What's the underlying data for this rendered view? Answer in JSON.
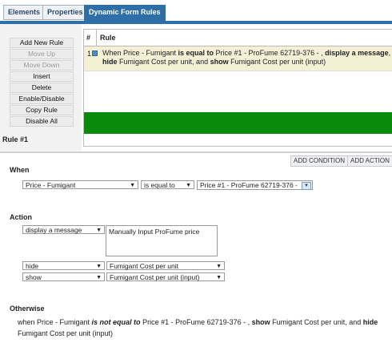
{
  "tabs": [
    {
      "label": "Elements"
    },
    {
      "label": "Properties"
    },
    {
      "label": "Dynamic Form Rules"
    }
  ],
  "left_buttons": [
    {
      "label": "Add New Rule"
    },
    {
      "label": "Move Up"
    },
    {
      "label": "Move Down"
    },
    {
      "label": "Insert"
    },
    {
      "label": "Delete"
    },
    {
      "label": "Enable/Disable"
    },
    {
      "label": "Copy Rule"
    },
    {
      "label": "Disable All"
    }
  ],
  "table": {
    "col_num": "#",
    "col_rule": "Rule",
    "row": {
      "num": "1",
      "parts": [
        "When Price - Fumigant ",
        "is equal to",
        " Price #1 - ProFume 62719-376 - , ",
        "display a message",
        ", ",
        "hide",
        " Fumigant Cost per unit, and ",
        "show",
        " Fumigant Cost per unit (input)"
      ]
    }
  },
  "rule_title": "Rule #1",
  "actions_toolbar": {
    "add_condition": "ADD CONDITION",
    "add_action": "ADD ACTION"
  },
  "when": {
    "heading": "When",
    "field": "Price - Fumigant",
    "operator": "is equal to",
    "value": "Price #1 - ProFume 62719-376 -"
  },
  "action": {
    "heading": "Action",
    "rows": [
      {
        "type": "display a message",
        "target": "Manually Input ProFume price"
      },
      {
        "type": "hide",
        "target": "Fumigant Cost per unit"
      },
      {
        "type": "show",
        "target": "Fumigant Cost per unit (input)"
      }
    ]
  },
  "otherwise": {
    "heading": "Otherwise",
    "parts": [
      "when Price - Fumigant ",
      "is not equal to",
      " Price #1 - ProFume 62719-376 - , ",
      "show",
      " Fumigant Cost per unit, and ",
      "hide",
      " Fumigant Cost per unit (input)"
    ]
  }
}
